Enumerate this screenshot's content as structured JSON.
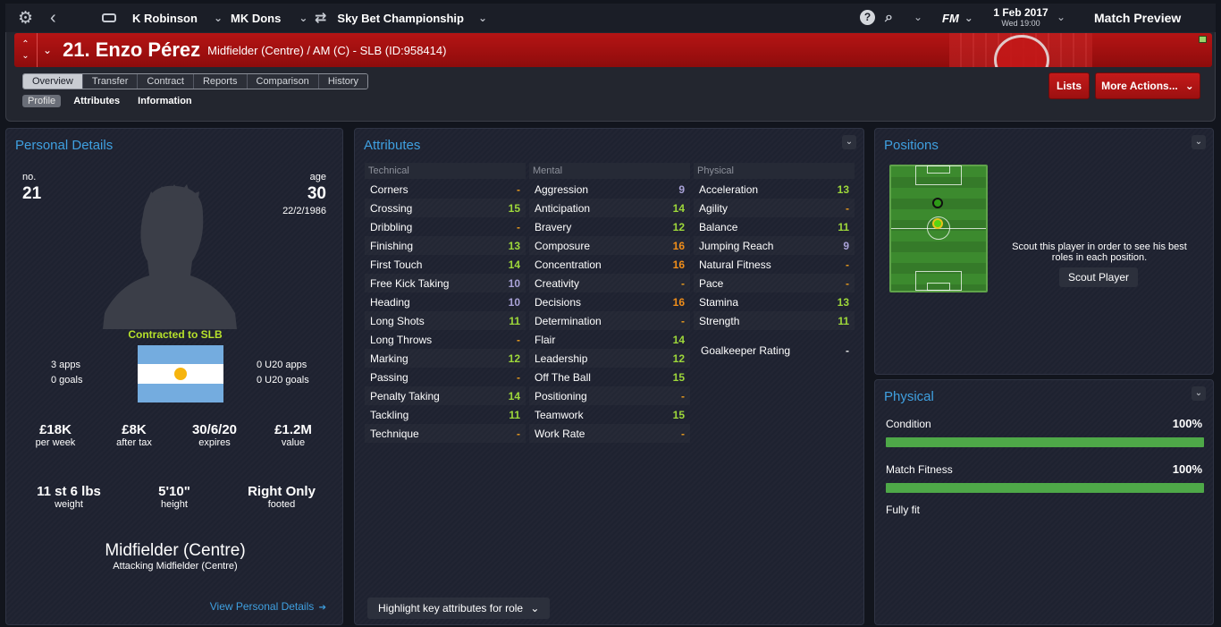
{
  "topbar": {
    "manager": "K Robinson",
    "club": "MK Dons",
    "competition": "Sky Bet Championship",
    "date": "1 Feb 2017",
    "day_time": "Wed 19:00",
    "fm_label": "FM",
    "continue": "Match Preview"
  },
  "player": {
    "name": "21. Enzo Pérez",
    "description": "Midfielder (Centre) / AM (C) - SLB (ID:958414)"
  },
  "tabs": [
    "Overview",
    "Transfer",
    "Contract",
    "Reports",
    "Comparison",
    "History"
  ],
  "subtabs": [
    "Profile",
    "Attributes",
    "Information"
  ],
  "buttons": {
    "lists": "Lists",
    "more_actions": "More Actions..."
  },
  "personal": {
    "title": "Personal Details",
    "no_label": "no.",
    "no_value": "21",
    "age_label": "age",
    "age_value": "30",
    "dob": "22/2/1986",
    "contracted": "Contracted to SLB",
    "apps": "3 apps",
    "goals": "0 goals",
    "u20_apps": "0 U20 apps",
    "u20_goals": "0 U20 goals",
    "wage": "£18K",
    "wage_label": "per week",
    "after_tax": "£8K",
    "after_tax_label": "after tax",
    "expires": "30/6/20",
    "expires_label": "expires",
    "value": "£1.2M",
    "value_label": "value",
    "weight": "11 st 6 lbs",
    "weight_label": "weight",
    "height": "5'10\"",
    "height_label": "height",
    "foot": "Right Only",
    "foot_label": "footed",
    "position": "Midfielder (Centre)",
    "position_sub": "Attacking Midfielder (Centre)",
    "view_link": "View Personal Details"
  },
  "attributes": {
    "title": "Attributes",
    "highlight": "Highlight key attributes for role",
    "technical": {
      "header": "Technical",
      "rows": [
        {
          "name": "Corners",
          "value": "-",
          "cls": "v-dash"
        },
        {
          "name": "Crossing",
          "value": "15",
          "cls": "v-green"
        },
        {
          "name": "Dribbling",
          "value": "-",
          "cls": "v-dash"
        },
        {
          "name": "Finishing",
          "value": "13",
          "cls": "v-green"
        },
        {
          "name": "First Touch",
          "value": "14",
          "cls": "v-green"
        },
        {
          "name": "Free Kick Taking",
          "value": "10",
          "cls": "v-purple"
        },
        {
          "name": "Heading",
          "value": "10",
          "cls": "v-purple"
        },
        {
          "name": "Long Shots",
          "value": "11",
          "cls": "v-green"
        },
        {
          "name": "Long Throws",
          "value": "-",
          "cls": "v-dash"
        },
        {
          "name": "Marking",
          "value": "12",
          "cls": "v-green"
        },
        {
          "name": "Passing",
          "value": "-",
          "cls": "v-dash"
        },
        {
          "name": "Penalty Taking",
          "value": "14",
          "cls": "v-green"
        },
        {
          "name": "Tackling",
          "value": "11",
          "cls": "v-green"
        },
        {
          "name": "Technique",
          "value": "-",
          "cls": "v-dash"
        }
      ]
    },
    "mental": {
      "header": "Mental",
      "rows": [
        {
          "name": "Aggression",
          "value": "9",
          "cls": "v-purple"
        },
        {
          "name": "Anticipation",
          "value": "14",
          "cls": "v-green"
        },
        {
          "name": "Bravery",
          "value": "12",
          "cls": "v-green"
        },
        {
          "name": "Composure",
          "value": "16",
          "cls": "v-orange"
        },
        {
          "name": "Concentration",
          "value": "16",
          "cls": "v-orange"
        },
        {
          "name": "Creativity",
          "value": "-",
          "cls": "v-dash"
        },
        {
          "name": "Decisions",
          "value": "16",
          "cls": "v-orange"
        },
        {
          "name": "Determination",
          "value": "-",
          "cls": "v-dash"
        },
        {
          "name": "Flair",
          "value": "14",
          "cls": "v-green"
        },
        {
          "name": "Leadership",
          "value": "12",
          "cls": "v-green"
        },
        {
          "name": "Off The Ball",
          "value": "15",
          "cls": "v-green"
        },
        {
          "name": "Positioning",
          "value": "-",
          "cls": "v-dash"
        },
        {
          "name": "Teamwork",
          "value": "15",
          "cls": "v-green"
        },
        {
          "name": "Work Rate",
          "value": "-",
          "cls": "v-dash"
        }
      ]
    },
    "physical": {
      "header": "Physical",
      "rows": [
        {
          "name": "Acceleration",
          "value": "13",
          "cls": "v-green"
        },
        {
          "name": "Agility",
          "value": "-",
          "cls": "v-dash"
        },
        {
          "name": "Balance",
          "value": "11",
          "cls": "v-green"
        },
        {
          "name": "Jumping Reach",
          "value": "9",
          "cls": "v-purple"
        },
        {
          "name": "Natural Fitness",
          "value": "-",
          "cls": "v-dash"
        },
        {
          "name": "Pace",
          "value": "-",
          "cls": "v-dash"
        },
        {
          "name": "Stamina",
          "value": "13",
          "cls": "v-green"
        },
        {
          "name": "Strength",
          "value": "11",
          "cls": "v-green"
        }
      ],
      "gk_label": "Goalkeeper Rating",
      "gk_value": "-"
    }
  },
  "positions": {
    "title": "Positions",
    "scout_text": "Scout this player in order to see his best roles in each position.",
    "scout_button": "Scout Player"
  },
  "physical_panel": {
    "title": "Physical",
    "condition_label": "Condition",
    "condition_value": "100%",
    "fitness_label": "Match Fitness",
    "fitness_value": "100%",
    "status": "Fully fit"
  }
}
